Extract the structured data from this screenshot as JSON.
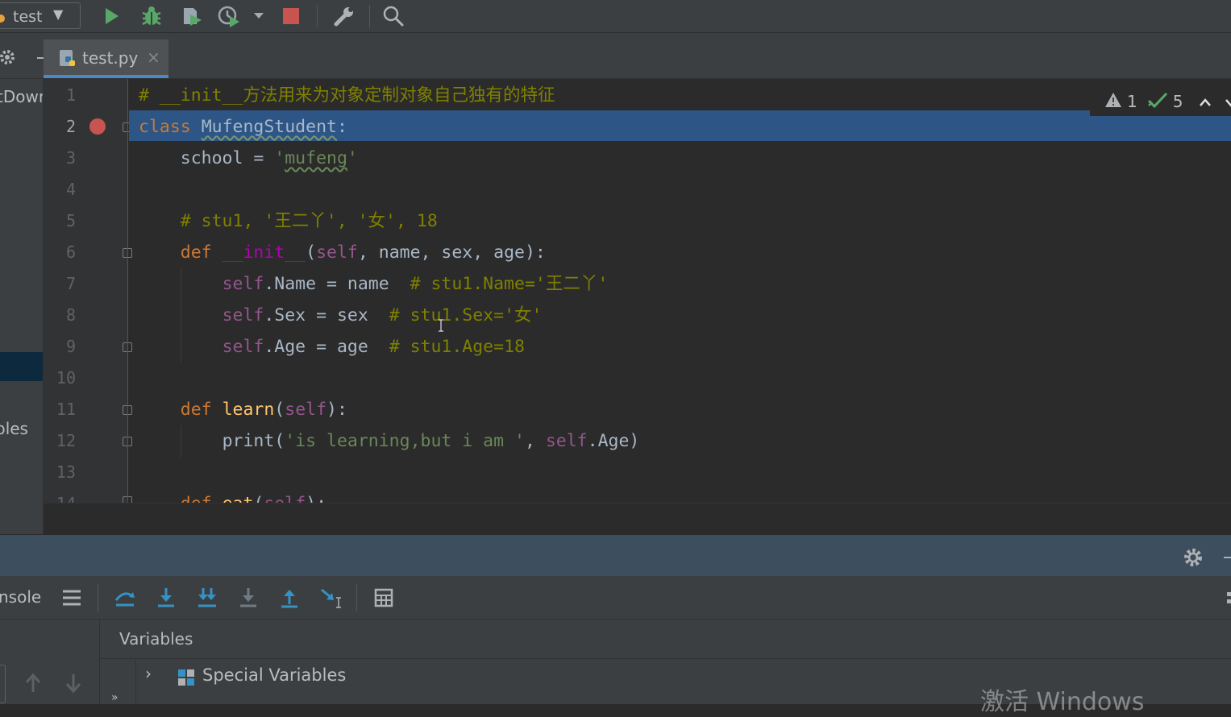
{
  "toolbar": {
    "run_config": "test",
    "buttons": [
      "run-icon",
      "debug-icon",
      "coverage-icon",
      "profile-icon",
      "profile-dropdown-icon",
      "stop-icon",
      "settings-wrench-icon",
      "search-icon"
    ]
  },
  "tab": {
    "filename": "test.py",
    "close": "×"
  },
  "project_panel": {
    "partial_text_1": "tDown",
    "partial_text_2": "bles"
  },
  "editor": {
    "line_numbers": [
      "1",
      "2",
      "3",
      "4",
      "5",
      "6",
      "7",
      "8",
      "9",
      "10",
      "11",
      "12",
      "13",
      "14"
    ],
    "current_line": 2,
    "breakpoint_line": 2,
    "inspections": {
      "warnings": "1",
      "ok": "5"
    },
    "code": {
      "l1": "# __init__方法用来为对象定制对象自己独有的特征",
      "l2_kw": "class",
      "l2_name": "MufengStudent",
      "l2_colon": ":",
      "l3_var": "school = ",
      "l3_q1": "'",
      "l3_str": "mufeng",
      "l3_q2": "'",
      "l5": "# stu1, '王二丫', '女', 18",
      "l6_def": "def ",
      "l6_fn": "__init__",
      "l6_open": "(",
      "l6_self": "self",
      "l6_rest": ", name, sex, age):",
      "l7_self": "self",
      "l7_code": ".Name = name  ",
      "l7_cm": "# stu1.Name='王二丫'",
      "l8_self": "self",
      "l8_code": ".Sex = sex  ",
      "l8_cm": "# stu1.Sex='女'",
      "l9_self": "self",
      "l9_code": ".Age = age  ",
      "l9_cm": "# stu1.Age=18",
      "l11_def": "def ",
      "l11_fn": "learn",
      "l11_open": "(",
      "l11_self": "self",
      "l11_close": "):",
      "l12_print": "print(",
      "l12_str": "'is learning,but i am '",
      "l12_mid": ", ",
      "l12_self": "self",
      "l12_end": ".Age)",
      "l14_def": "def ",
      "l14_fn": "eat",
      "l14_open": "(",
      "l14_self": "self",
      "l14_close": "):"
    }
  },
  "debug": {
    "tab_console": "nsole",
    "variables_label": "Variables",
    "special_variables": "Special Variables",
    "chevron": "›",
    "toolbar_icons": [
      "show-execution-point-icon",
      "step-over-icon",
      "step-into-icon",
      "step-into-my-code-icon",
      "force-step-into-icon",
      "step-out-icon",
      "run-to-cursor-icon",
      "evaluate-expression-icon"
    ]
  },
  "watermark": "激活 Windows",
  "colors": {
    "editor_bg": "#2b2b2b",
    "selection": "#2d5686",
    "keyword": "#cc7832",
    "comment": "#808000",
    "string": "#6a8759",
    "self": "#94558d",
    "function": "#ffc66d",
    "magic": "#b200b2",
    "breakpoint": "#c75450",
    "accent": "#4a88c7"
  }
}
